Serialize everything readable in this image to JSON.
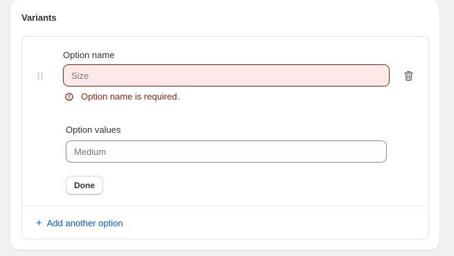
{
  "card": {
    "title": "Variants"
  },
  "option": {
    "name_label": "Option name",
    "name_placeholder": "Size",
    "name_value": "",
    "error_message": "Option name is required.",
    "values_label": "Option values",
    "values_placeholder": "Medium",
    "values_value": "",
    "done_label": "Done"
  },
  "add_option": {
    "plus": "+",
    "label": "Add another option"
  },
  "icons": {
    "drag": "drag-handle-icon",
    "delete": "trash-icon",
    "error": "alert-circle-icon"
  },
  "colors": {
    "error_text": "#8e1f0b",
    "error_bg": "#fee9e8",
    "link": "#005bd3",
    "title": "#303030"
  }
}
